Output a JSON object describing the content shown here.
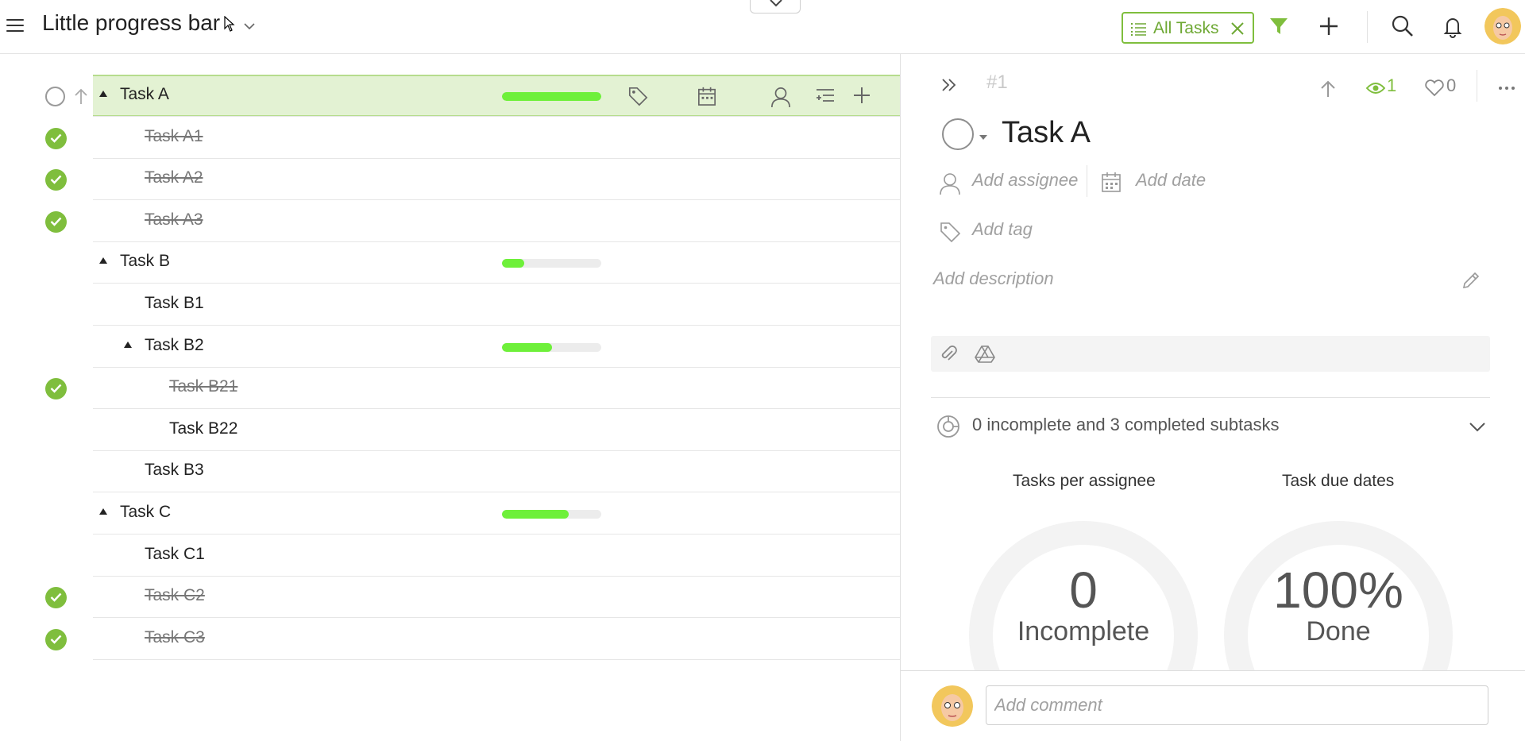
{
  "project": {
    "title": "Little progress bar"
  },
  "filter": {
    "label": "All Tasks"
  },
  "tasks": [
    {
      "name": "Task A",
      "done": false,
      "level": 0,
      "expandable": true,
      "progress": 1.0
    },
    {
      "name": "Task A1",
      "done": true,
      "level": 1,
      "expandable": false,
      "progress": null
    },
    {
      "name": "Task A2",
      "done": true,
      "level": 1,
      "expandable": false,
      "progress": null
    },
    {
      "name": "Task A3",
      "done": true,
      "level": 1,
      "expandable": false,
      "progress": null
    },
    {
      "name": "Task B",
      "done": false,
      "level": 0,
      "expandable": true,
      "progress": 0.22
    },
    {
      "name": "Task B1",
      "done": false,
      "level": 1,
      "expandable": false,
      "progress": null
    },
    {
      "name": "Task B2",
      "done": false,
      "level": 1,
      "expandable": true,
      "progress": 0.5
    },
    {
      "name": "Task B21",
      "done": true,
      "level": 2,
      "expandable": false,
      "progress": null
    },
    {
      "name": "Task B22",
      "done": false,
      "level": 2,
      "expandable": false,
      "progress": null
    },
    {
      "name": "Task B3",
      "done": false,
      "level": 1,
      "expandable": false,
      "progress": null
    },
    {
      "name": "Task C",
      "done": false,
      "level": 0,
      "expandable": true,
      "progress": 0.67
    },
    {
      "name": "Task C1",
      "done": false,
      "level": 1,
      "expandable": false,
      "progress": null
    },
    {
      "name": "Task C2",
      "done": true,
      "level": 1,
      "expandable": false,
      "progress": null
    },
    {
      "name": "Task C3",
      "done": true,
      "level": 1,
      "expandable": false,
      "progress": null
    }
  ],
  "details": {
    "task_number": "#1",
    "title": "Task A",
    "watchers": "1",
    "likes": "0",
    "add_assignee": "Add assignee",
    "add_date": "Add date",
    "add_tag": "Add tag",
    "add_description": "Add description",
    "subtask_summary": "0 incomplete and 3 completed subtasks",
    "stats": {
      "per_assignee_label": "Tasks per assignee",
      "due_dates_label": "Task due dates",
      "incomplete_value": "0",
      "incomplete_label": "Incomplete",
      "done_value": "100%",
      "done_label": "Done"
    },
    "comment_placeholder": "Add comment"
  },
  "colors": {
    "accent_green": "#7fbe3d",
    "progress_green": "#6ef03a",
    "selected_row": "#e3f2d3"
  },
  "icons": [
    "menu-icon",
    "chevron-down-icon",
    "list-icon",
    "close-icon",
    "filter-icon",
    "plus-icon",
    "search-icon",
    "bell-icon",
    "tag-icon",
    "calendar-icon",
    "user-icon",
    "add-subtask-icon",
    "arrow-up-icon",
    "eye-icon",
    "heart-icon",
    "more-icon",
    "double-chevron-right-icon",
    "pencil-icon",
    "paperclip-icon",
    "drive-icon",
    "pie-chart-icon"
  ]
}
